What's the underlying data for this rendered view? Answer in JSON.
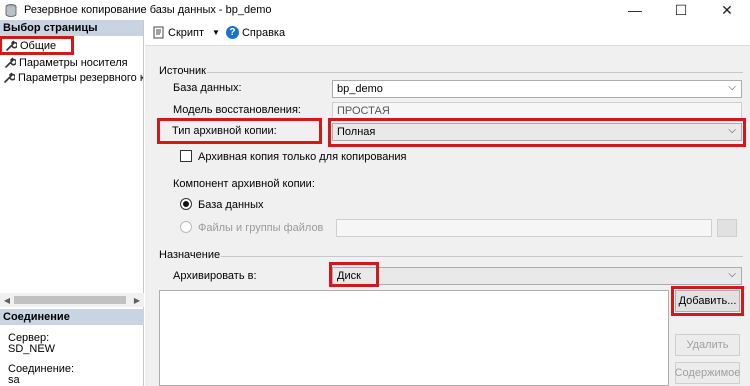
{
  "window": {
    "title": "Резервное копирование базы данных - bp_demo",
    "minimize_glyph": "—",
    "maximize_glyph": "☐",
    "close_glyph": "✕"
  },
  "left": {
    "pages_header": "Выбор страницы",
    "pages": [
      {
        "label": "Общие",
        "icon": "wrench-icon",
        "selected": true
      },
      {
        "label": "Параметры носителя",
        "icon": "wrench-icon"
      },
      {
        "label": "Параметры резервного копир",
        "icon": "wrench-icon"
      }
    ],
    "connection_header": "Соединение",
    "server_label": "Сервер:",
    "server_value": "SD_NEW",
    "connection_label": "Соединение:",
    "connection_value": "sa"
  },
  "toolbar": {
    "script_label": "Скрипт",
    "help_label": "Справка"
  },
  "source": {
    "group_label": "Источник",
    "database_label": "База данных:",
    "database_value": "bp_demo",
    "recovery_label": "Модель восстановления:",
    "recovery_value": "ПРОСТАЯ",
    "backup_type_label": "Тип архивной копии:",
    "backup_type_value": "Полная",
    "copy_only_label": "Архивная копия только для копирования",
    "copy_only_checked": false,
    "component_label": "Компонент архивной копии:",
    "component_options": [
      "База данных",
      "Файлы и группы файлов"
    ],
    "component_selected": "База данных"
  },
  "destination": {
    "group_label": "Назначение",
    "archive_to_label": "Архивировать в:",
    "archive_to_value": "Диск",
    "add_button": "Добавить...",
    "remove_button": "Удалить",
    "contents_button": "Содержимое"
  },
  "colors": {
    "highlight": "#d0191a",
    "section_header": "#c9d4e3",
    "help_icon": "#1a73c8"
  }
}
